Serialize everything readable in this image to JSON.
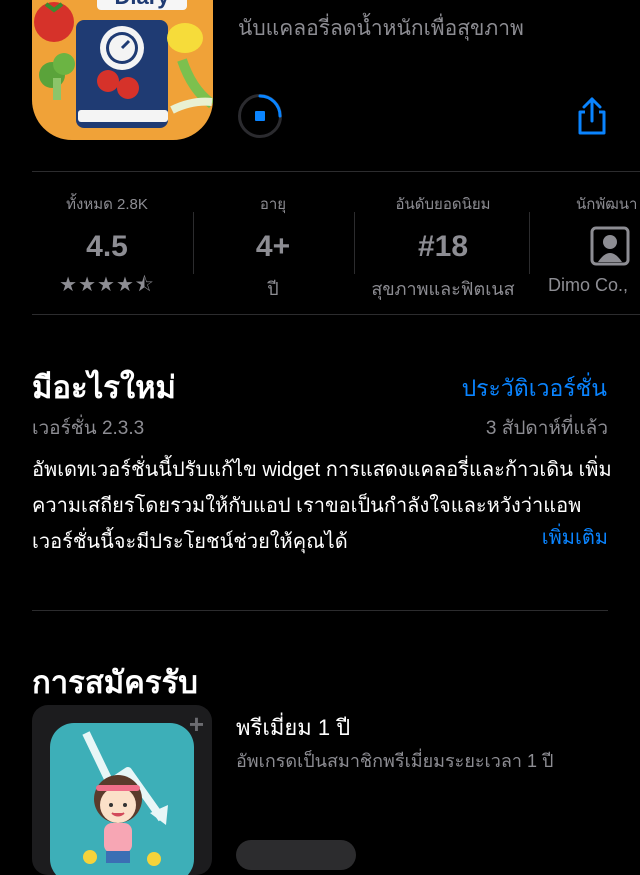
{
  "app": {
    "icon_label": "Diary",
    "subtitle": "นับแคลอรี่ลดน้ำหนักเพื่อสุขภาพ",
    "accent_color": "#0a84ff",
    "icon_bg_color": "#f0a238"
  },
  "download": {
    "state": "downloading",
    "progress": 0.25
  },
  "stats": [
    {
      "caption": "ทั้งหมด 2.8K",
      "value": "4.5",
      "stars": "★★★★⯪"
    },
    {
      "caption": "อายุ",
      "value": "4+",
      "sub": "ปี"
    },
    {
      "caption": "อันดับยอดนิยม",
      "value": "#18",
      "sub": "สุขภาพและฟิตเนส"
    },
    {
      "caption": "นักพัฒนา",
      "value": "developer-icon",
      "sub": "Dimo Co.,"
    }
  ],
  "whats_new": {
    "title": "มีอะไรใหม่",
    "history_link": "ประวัติเวอร์ชั่น",
    "version": "เวอร์ชั่น 2.3.3",
    "date": "3 สัปดาห์ที่แล้ว",
    "notes": "อัพเดทเวอร์ชั่นนี้ปรับแก้ไข widget การแสดงแคลอรี่และก้าวเดิน เพิ่มความเสถียรโดยรวมให้กับแอป เราขอเป็นกำลังใจและหวังว่าแอพเวอร์ชั่นนี้จะมีประโยชน์ช่วยให้คุณได้",
    "more": "เพิ่มเติม"
  },
  "subscription": {
    "title": "การสมัครรับ",
    "name": "พรีเมี่ยม 1 ปี",
    "description": "อัพเกรดเป็นสมาชิกพรีเมี่ยมระยะเวลา 1 ปี"
  }
}
